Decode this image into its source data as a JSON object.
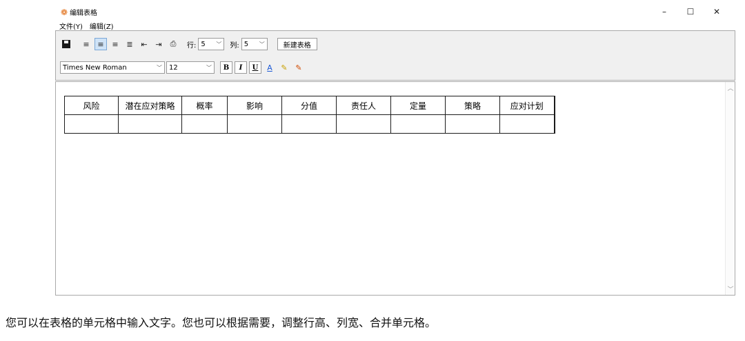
{
  "window": {
    "title": "编辑表格",
    "controls": {
      "minimize": "–",
      "maximize": "☐",
      "close": "✕"
    }
  },
  "menu": [
    "文件(Y)",
    "编辑(Z)"
  ],
  "toolbar": {
    "row_label": "行:",
    "row_value": "5",
    "col_label": "列:",
    "col_value": "5",
    "new_table_label": "新建表格",
    "font_name": "Times New Roman",
    "font_size": "12",
    "bold_label": "B",
    "italic_label": "I",
    "underline_label": "U",
    "font_color_label": "A"
  },
  "table": {
    "headers": [
      "风险",
      "潜在应对策略",
      "概率",
      "影响",
      "分值",
      "责任人",
      "定量",
      "策略",
      "应对计划"
    ],
    "rows": [
      [
        "",
        "",
        "",
        "",
        "",
        "",
        "",
        "",
        ""
      ]
    ]
  },
  "caption": "您可以在表格的单元格中输入文字。您也可以根据需要，调整行高、列宽、合并单元格。"
}
